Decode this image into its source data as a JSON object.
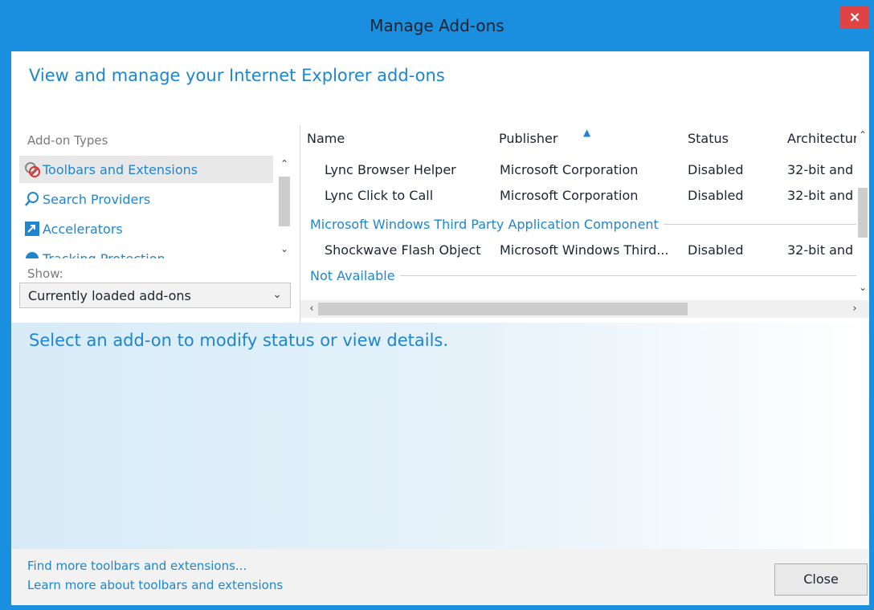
{
  "window": {
    "title": "Manage Add-ons",
    "close_glyph": "×"
  },
  "header": {
    "text": "View and manage your Internet Explorer add-ons"
  },
  "left": {
    "types_label": "Add-on Types",
    "types": [
      {
        "label": "Toolbars and Extensions",
        "icon": "toolbars-extensions-icon"
      },
      {
        "label": "Search Providers",
        "icon": "search-icon"
      },
      {
        "label": "Accelerators",
        "icon": "accelerators-icon"
      },
      {
        "label": "Tracking Protection",
        "icon": "tracking-protection-icon"
      }
    ],
    "show_label": "Show:",
    "show_value": "Currently loaded add-ons"
  },
  "list": {
    "columns": [
      "Name",
      "Publisher",
      "Status",
      "Architectur"
    ],
    "rows": [
      {
        "name": "Lync Browser Helper",
        "publisher": "Microsoft Corporation",
        "status": "Disabled",
        "arch": "32-bit and"
      },
      {
        "name": "Lync Click to Call",
        "publisher": "Microsoft Corporation",
        "status": "Disabled",
        "arch": "32-bit and"
      },
      {
        "name": "Shockwave Flash Object",
        "publisher": "Microsoft Windows Third...",
        "status": "Disabled",
        "arch": "32-bit and"
      }
    ],
    "groups": [
      "Microsoft Windows Third Party Application Component",
      "Not Available"
    ]
  },
  "details": {
    "text": "Select an add-on to modify status or view details."
  },
  "footer": {
    "link1": "Find more toolbars and extensions...",
    "link2": "Learn more about toolbars and extensions",
    "close_label": "Close"
  },
  "colors": {
    "accent": "#1a8fe0",
    "link": "#1e86d0",
    "close": "#e04343"
  }
}
